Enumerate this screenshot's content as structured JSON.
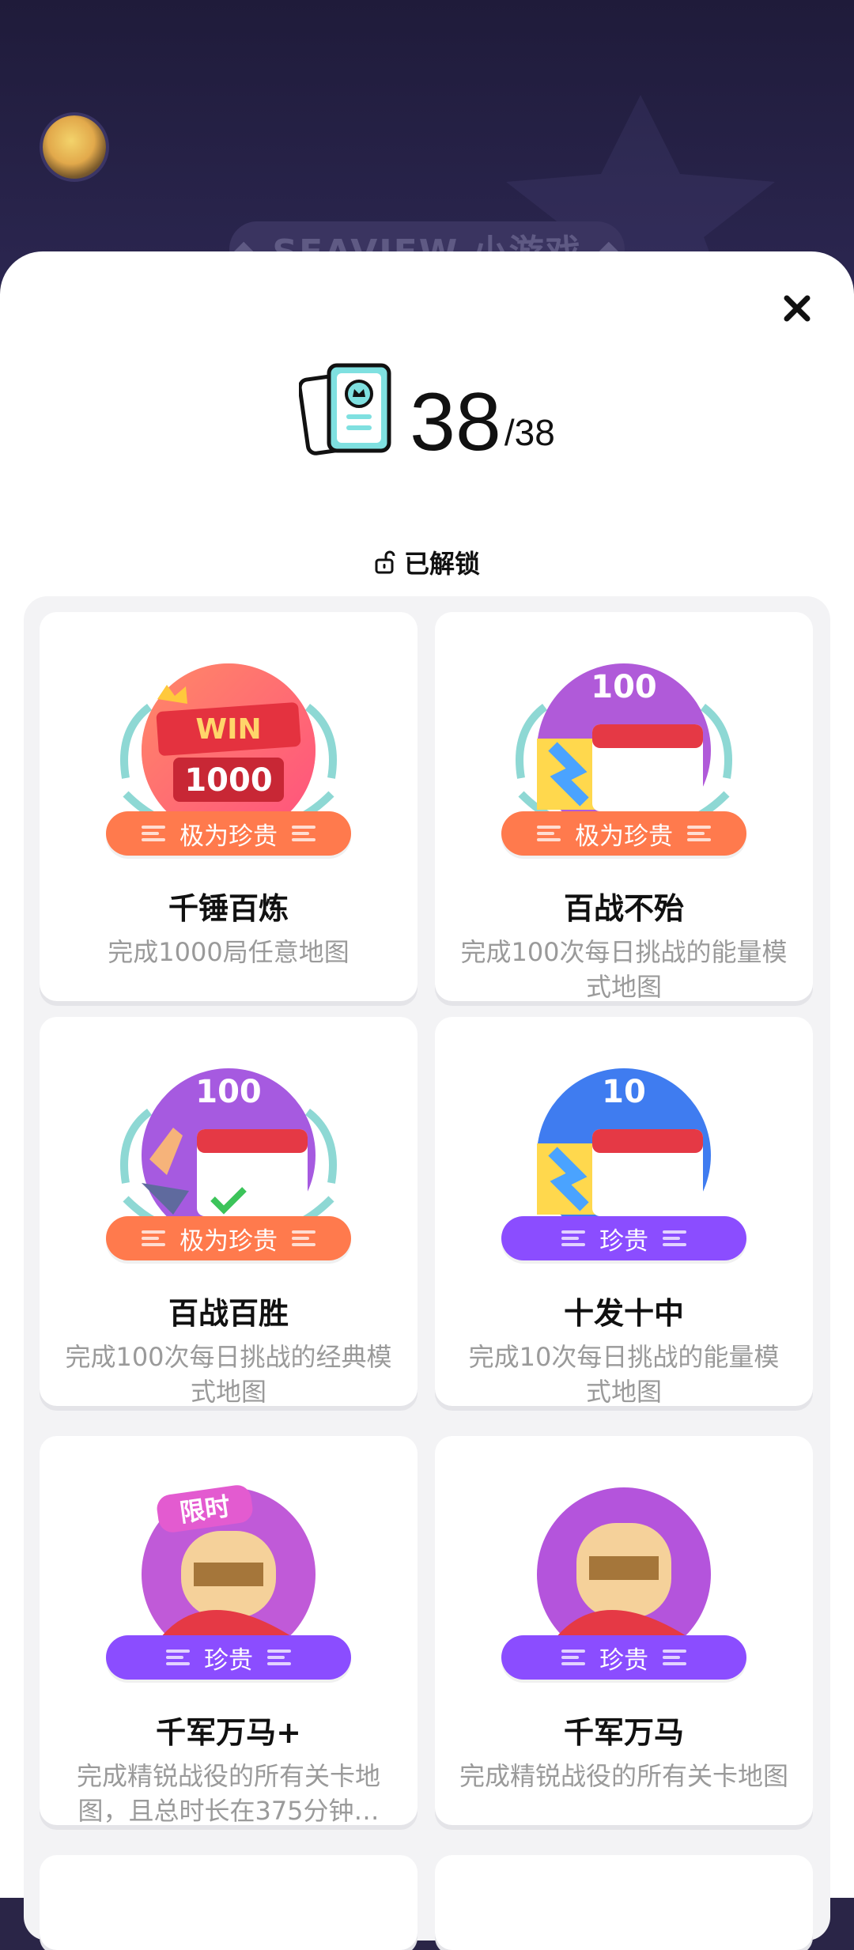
{
  "header": {
    "banner_text": "◆ SEAVIEW 小游戏 ◆"
  },
  "sheet": {
    "close_label": "×",
    "count_current": "38",
    "count_total": "/38",
    "unlocked_label": "已解锁"
  },
  "colors": {
    "rarity_orange": "#ff7a4d",
    "rarity_purple": "#8b4dff"
  },
  "achievements": [
    {
      "title": "千锤百炼",
      "desc": "完成1000局任意地图",
      "rarity": "极为珍贵",
      "rarity_color": "orange",
      "icon": "win-1000-badge-icon",
      "badge_text": "1000"
    },
    {
      "title": "百战不殆",
      "desc": "完成100次每日挑战的能量模式地图",
      "rarity": "极为珍贵",
      "rarity_color": "orange",
      "icon": "energy-100-calendar-badge-icon",
      "badge_text": "100"
    },
    {
      "title": "百战百胜",
      "desc": "完成100次每日挑战的经典模式地图",
      "rarity": "极为珍贵",
      "rarity_color": "orange",
      "icon": "classic-100-calendar-badge-icon",
      "badge_text": "100"
    },
    {
      "title": "十发十中",
      "desc": "完成10次每日挑战的能量模式地图",
      "rarity": "珍贵",
      "rarity_color": "purple",
      "icon": "energy-10-calendar-badge-icon",
      "badge_text": "10"
    },
    {
      "title": "千军万马+",
      "desc": "完成精锐战役的所有关卡地图，且总时长在375分钟…",
      "rarity": "珍贵",
      "rarity_color": "purple",
      "icon": "knight-limited-badge-icon",
      "badge_text": "限时"
    },
    {
      "title": "千军万马",
      "desc": "完成精锐战役的所有关卡地图",
      "rarity": "珍贵",
      "rarity_color": "purple",
      "icon": "knight-badge-icon",
      "badge_text": ""
    }
  ]
}
